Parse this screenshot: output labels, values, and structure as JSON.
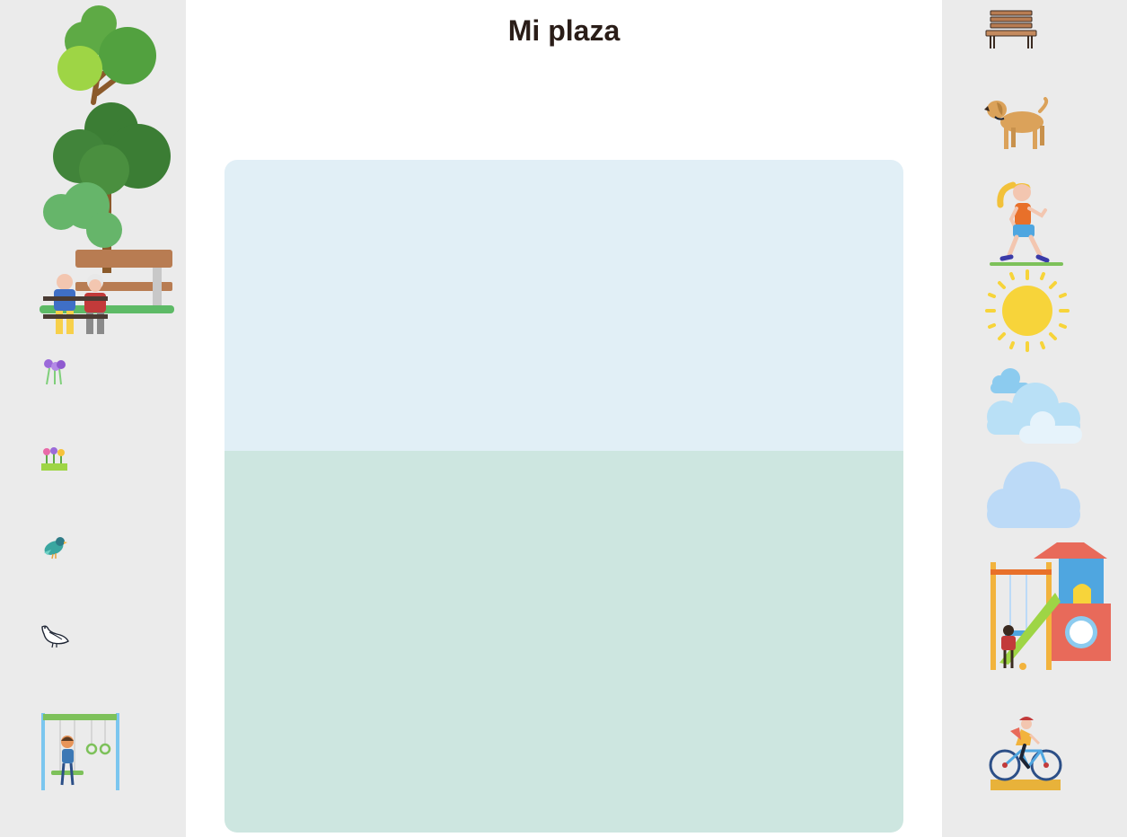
{
  "page": {
    "title": "Mi plaza"
  },
  "palette": {
    "sidebar_bg": "#ebebeb",
    "sky": "#e1eff6",
    "ground": "#cde6e0",
    "title_color": "#2a1d18"
  },
  "stickers_left": [
    {
      "name": "park-bench-trees-elders-sticker",
      "icon": "trees-with-elderly-couple-on-bench"
    },
    {
      "name": "purple-flowers-sticker",
      "icon": "purple-flowers"
    },
    {
      "name": "flower-bed-sticker",
      "icon": "flower-bed"
    },
    {
      "name": "bird-sticker",
      "icon": "blue-bird"
    },
    {
      "name": "pigeon-sticker",
      "icon": "pigeon"
    },
    {
      "name": "swing-set-sticker",
      "icon": "swing-set-with-child"
    }
  ],
  "stickers_right": [
    {
      "name": "bench-sticker",
      "icon": "wooden-bench"
    },
    {
      "name": "dog-sticker",
      "icon": "dog"
    },
    {
      "name": "jogger-sticker",
      "icon": "running-girl"
    },
    {
      "name": "sun-sticker",
      "icon": "sun"
    },
    {
      "name": "clouds-sticker",
      "icon": "cluster-of-clouds"
    },
    {
      "name": "cloud-sticker",
      "icon": "single-cloud"
    },
    {
      "name": "playground-sticker",
      "icon": "playground-slide-swing"
    },
    {
      "name": "cyclist-sticker",
      "icon": "cyclist"
    }
  ]
}
